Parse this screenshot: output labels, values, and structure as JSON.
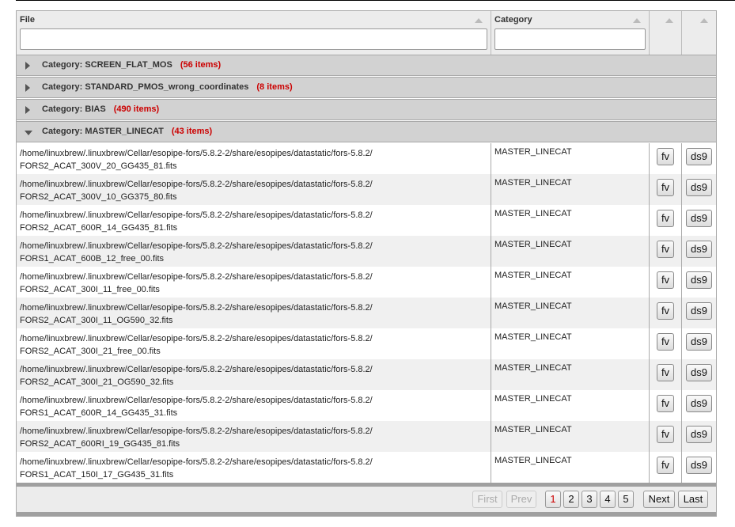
{
  "header": {
    "file_label": "File",
    "category_label": "Category",
    "file_filter_value": "",
    "category_filter_value": ""
  },
  "categories": [
    {
      "name": "Category: SCREEN_FLAT_MOS",
      "count": "(56 items)"
    },
    {
      "name": "Category: STANDARD_PMOS_wrong_coordinates",
      "count": "(8 items)"
    },
    {
      "name": "Category: BIAS",
      "count": "(490 items)"
    },
    {
      "name": "Category: MASTER_LINECAT",
      "count": "(43 items)"
    }
  ],
  "rows": [
    {
      "path1": "/home/linuxbrew/.linuxbrew/Cellar/esopipe-fors/5.8.2-2/share/esopipes/datastatic/fors-5.8.2/",
      "path2": "FORS2_ACAT_300V_20_GG435_81.fits",
      "category": "MASTER_LINECAT",
      "fv": "fv",
      "ds9": "ds9"
    },
    {
      "path1": "/home/linuxbrew/.linuxbrew/Cellar/esopipe-fors/5.8.2-2/share/esopipes/datastatic/fors-5.8.2/",
      "path2": "FORS2_ACAT_300V_10_GG375_80.fits",
      "category": "MASTER_LINECAT",
      "fv": "fv",
      "ds9": "ds9"
    },
    {
      "path1": "/home/linuxbrew/.linuxbrew/Cellar/esopipe-fors/5.8.2-2/share/esopipes/datastatic/fors-5.8.2/",
      "path2": "FORS2_ACAT_600R_14_GG435_81.fits",
      "category": "MASTER_LINECAT",
      "fv": "fv",
      "ds9": "ds9"
    },
    {
      "path1": "/home/linuxbrew/.linuxbrew/Cellar/esopipe-fors/5.8.2-2/share/esopipes/datastatic/fors-5.8.2/",
      "path2": "FORS1_ACAT_600B_12_free_00.fits",
      "category": "MASTER_LINECAT",
      "fv": "fv",
      "ds9": "ds9"
    },
    {
      "path1": "/home/linuxbrew/.linuxbrew/Cellar/esopipe-fors/5.8.2-2/share/esopipes/datastatic/fors-5.8.2/",
      "path2": "FORS2_ACAT_300I_11_free_00.fits",
      "category": "MASTER_LINECAT",
      "fv": "fv",
      "ds9": "ds9"
    },
    {
      "path1": "/home/linuxbrew/.linuxbrew/Cellar/esopipe-fors/5.8.2-2/share/esopipes/datastatic/fors-5.8.2/",
      "path2": "FORS2_ACAT_300I_11_OG590_32.fits",
      "category": "MASTER_LINECAT",
      "fv": "fv",
      "ds9": "ds9"
    },
    {
      "path1": "/home/linuxbrew/.linuxbrew/Cellar/esopipe-fors/5.8.2-2/share/esopipes/datastatic/fors-5.8.2/",
      "path2": "FORS2_ACAT_300I_21_free_00.fits",
      "category": "MASTER_LINECAT",
      "fv": "fv",
      "ds9": "ds9"
    },
    {
      "path1": "/home/linuxbrew/.linuxbrew/Cellar/esopipe-fors/5.8.2-2/share/esopipes/datastatic/fors-5.8.2/",
      "path2": "FORS2_ACAT_300I_21_OG590_32.fits",
      "category": "MASTER_LINECAT",
      "fv": "fv",
      "ds9": "ds9"
    },
    {
      "path1": "/home/linuxbrew/.linuxbrew/Cellar/esopipe-fors/5.8.2-2/share/esopipes/datastatic/fors-5.8.2/",
      "path2": "FORS1_ACAT_600R_14_GG435_31.fits",
      "category": "MASTER_LINECAT",
      "fv": "fv",
      "ds9": "ds9"
    },
    {
      "path1": "/home/linuxbrew/.linuxbrew/Cellar/esopipe-fors/5.8.2-2/share/esopipes/datastatic/fors-5.8.2/",
      "path2": "FORS2_ACAT_600RI_19_GG435_81.fits",
      "category": "MASTER_LINECAT",
      "fv": "fv",
      "ds9": "ds9"
    },
    {
      "path1": "/home/linuxbrew/.linuxbrew/Cellar/esopipe-fors/5.8.2-2/share/esopipes/datastatic/fors-5.8.2/",
      "path2": "FORS1_ACAT_150I_17_GG435_31.fits",
      "category": "MASTER_LINECAT",
      "fv": "fv",
      "ds9": "ds9"
    }
  ],
  "pager": {
    "first": "First",
    "prev": "Prev",
    "pages": [
      "1",
      "2",
      "3",
      "4",
      "5"
    ],
    "current": "1",
    "next": "Next",
    "last": "Last"
  }
}
